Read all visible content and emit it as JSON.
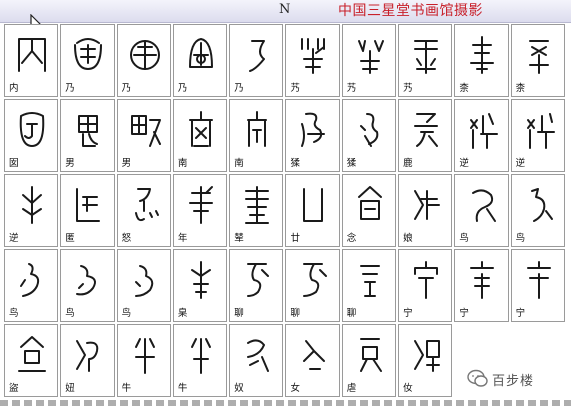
{
  "header": {
    "letter": "N",
    "title": "中国三星堂书画馆摄影"
  },
  "rows": [
    [
      "内",
      "乃",
      "乃",
      "乃",
      "乃",
      "艿",
      "艿",
      "艿",
      "柰",
      "柰"
    ],
    [
      "囡",
      "男",
      "男",
      "南",
      "南",
      "猱",
      "猱",
      "鹿",
      "逆",
      "逆"
    ],
    [
      "逆",
      "匿",
      "怒",
      "年",
      "辇",
      "廿",
      "念",
      "娘",
      "鸟",
      "鸟"
    ],
    [
      "鸟",
      "鸟",
      "鸟",
      "臬",
      "聊",
      "聊",
      "聊",
      "宁",
      "宁",
      "宁"
    ],
    [
      "盜",
      "妞",
      "牛",
      "牛",
      "奴",
      "女",
      "虐",
      "㚢",
      "",
      ""
    ]
  ],
  "watermark": {
    "text": "百步楼",
    "icon": "wechat-icon"
  }
}
